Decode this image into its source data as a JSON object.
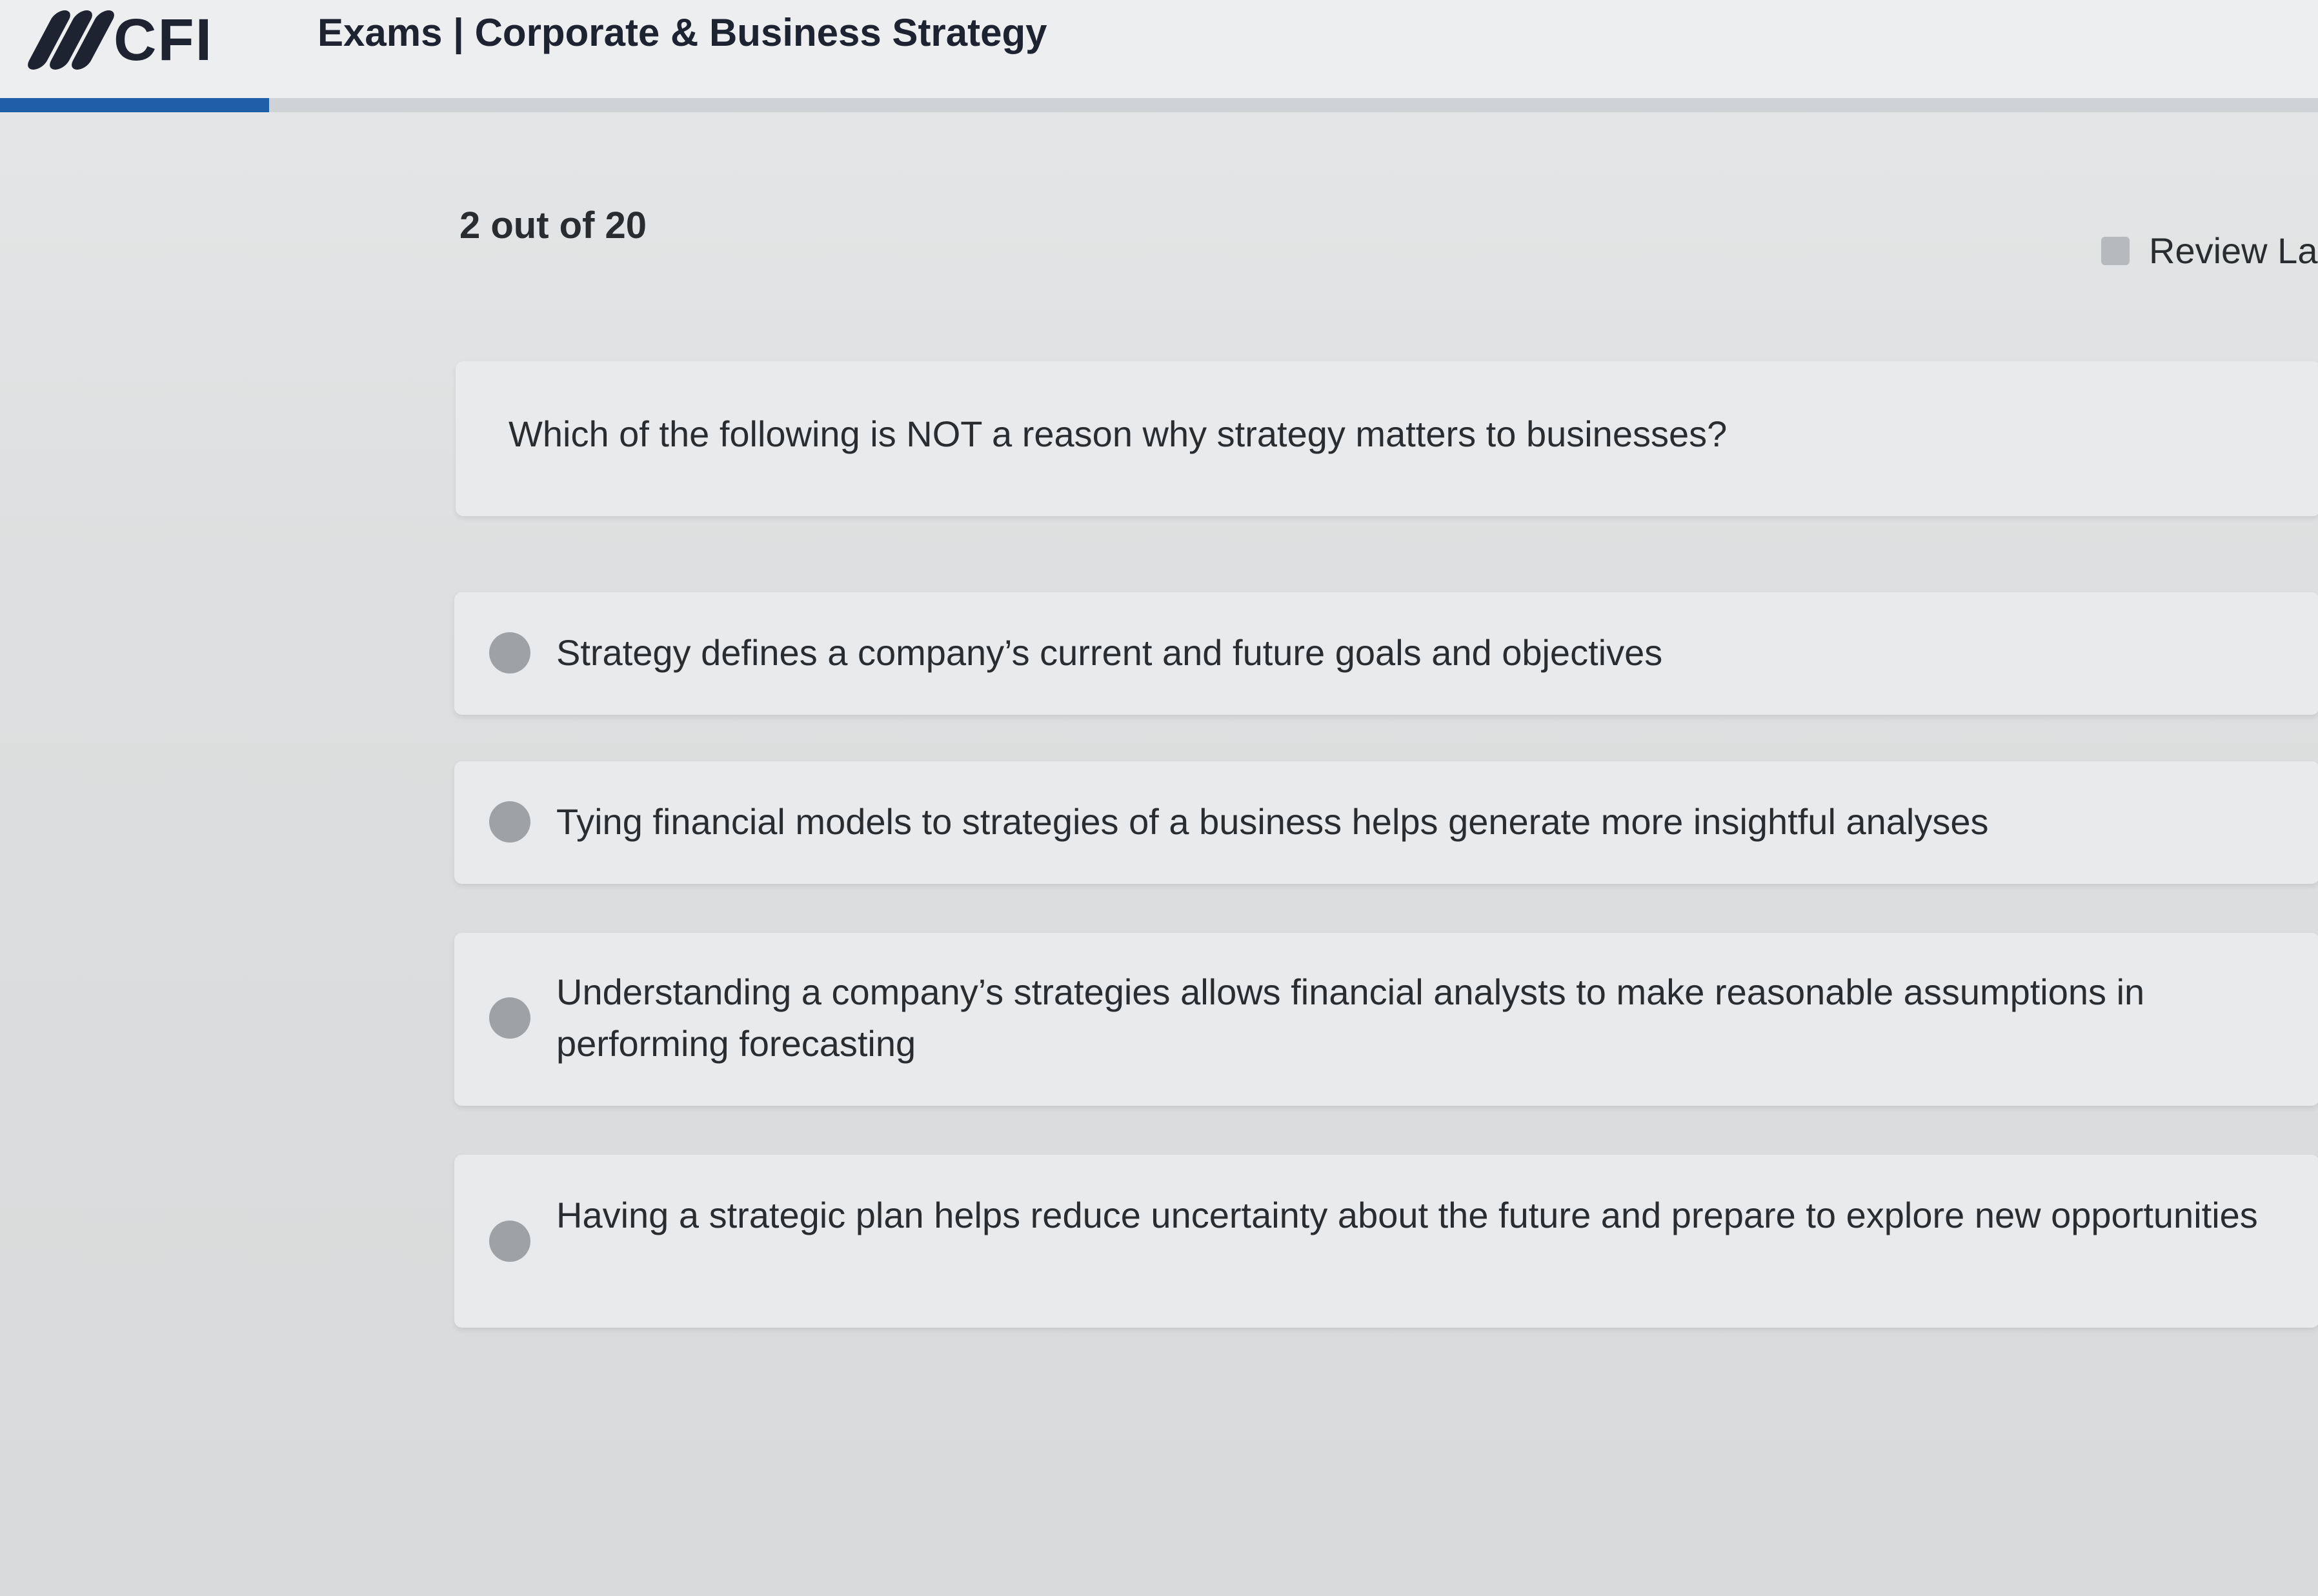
{
  "header": {
    "logo_text": "CFI",
    "title": "Exams | Corporate & Business Strategy",
    "progress_fraction": 0.1
  },
  "question_counter": "2 out of 20",
  "review_later_label": "Review La",
  "question": {
    "text": "Which of the following is NOT a reason why strategy matters to businesses?"
  },
  "options": [
    {
      "text": "Strategy defines a company’s current and future goals and objectives"
    },
    {
      "text": "Tying financial models to strategies of a business helps generate more insightful analyses"
    },
    {
      "text": "Understanding a company’s strategies allows financial analysts to make reasonable assumptions in performing forecasting"
    },
    {
      "text": "Having a strategic plan helps reduce uncertainty about the future and prepare to explore new opportunities"
    }
  ],
  "colors": {
    "accent": "#1e5fa8",
    "brand_dark": "#1d2330"
  }
}
